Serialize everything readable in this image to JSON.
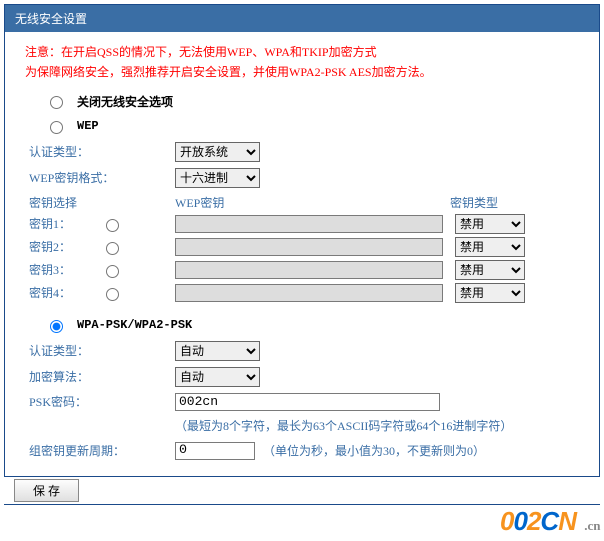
{
  "panel": {
    "title": "无线安全设置",
    "notice_line1": "注意：在开启QSS的情况下，无法使用WEP、WPA和TKIP加密方式",
    "notice_line2": "为保障网络安全，强烈推荐开启安全设置，并使用WPA2-PSK AES加密方法。"
  },
  "options": {
    "disable": {
      "label": "关闭无线安全选项",
      "selected": false
    },
    "wep": {
      "label": "WEP",
      "selected": false,
      "auth_type_label": "认证类型：",
      "auth_type_value": "开放系统",
      "key_format_label": "WEP密钥格式：",
      "key_format_value": "十六进制",
      "header_key_select": "密钥选择",
      "header_wep_key": "WEP密钥",
      "header_key_type": "密钥类型",
      "keys": [
        {
          "label": "密钥1：",
          "value": "",
          "type": "禁用"
        },
        {
          "label": "密钥2：",
          "value": "",
          "type": "禁用"
        },
        {
          "label": "密钥3：",
          "value": "",
          "type": "禁用"
        },
        {
          "label": "密钥4：",
          "value": "",
          "type": "禁用"
        }
      ]
    },
    "wpa": {
      "label": "WPA-PSK/WPA2-PSK",
      "selected": true,
      "auth_type_label": "认证类型：",
      "auth_type_value": "自动",
      "cipher_label": "加密算法：",
      "cipher_value": "自动",
      "psk_label": "PSK密码：",
      "psk_value": "002cn",
      "psk_hint": "（最短为8个字符，最长为63个ASCII码字符或64个16进制字符）",
      "group_key_label": "组密钥更新周期：",
      "group_key_value": "0",
      "group_key_hint": "（单位为秒，最小值为30，不更新则为0）"
    }
  },
  "buttons": {
    "save": "保 存"
  },
  "watermark": {
    "c1": "0",
    "c2": "0",
    "c3": "2",
    "c4": "C",
    "c5": "N",
    "suffix": ".cn"
  }
}
